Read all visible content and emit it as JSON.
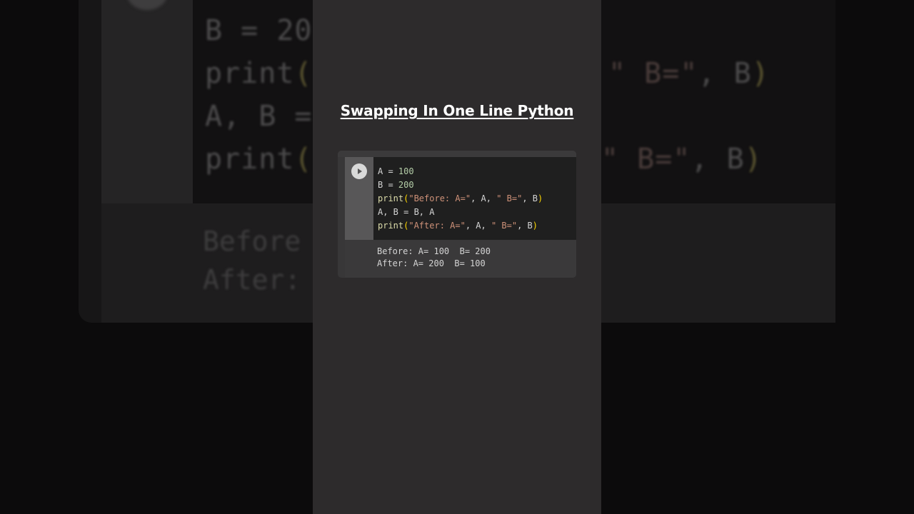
{
  "title": "Swapping In One Line Python",
  "cell": {
    "run_button": "run",
    "code": {
      "line1": {
        "a": "A = ",
        "b": "100"
      },
      "line2": {
        "a": "B = ",
        "b": "200"
      },
      "line3": {
        "fn": "print",
        "p1": "(",
        "s1": "\"Before: A=\"",
        "m1": ", A, ",
        "s2": "\" B=\"",
        "m2": ", B",
        "p2": ")"
      },
      "line4": {
        "a": "A, B = B, A"
      },
      "line5": {
        "fn": "print",
        "p1": "(",
        "s1": "\"After: A=\"",
        "m1": ", A, ",
        "s2": "\" B=\"",
        "m2": ", B",
        "p2": ")"
      }
    },
    "output": {
      "line1": "Before: A= 100  B= 200",
      "line2": "After: A= 200  B= 100"
    }
  },
  "backdrop": {
    "line_b": "B = 20",
    "line_print1_fn": "print",
    "line_print1_paren": "(",
    "line_print1_tail_s": "\" B=\"",
    "line_print1_tail_m": ", B",
    "line_print1_tail_p": ")",
    "line_swap": "A, B =",
    "line_print2_fn": "print",
    "line_print2_paren": "(",
    "line_print2_tail_s": "\" B=\"",
    "line_print2_tail_m": ", B",
    "line_print2_tail_p": ")",
    "out1": "Before",
    "out2": "After:"
  },
  "colors": {
    "frame": "#2d2b2c",
    "code_bg": "#1f1f1f",
    "output_bg": "#3a393a",
    "number": "#b5cea8",
    "function": "#dcdcaa",
    "string": "#ce9178",
    "paren": "#ffd700"
  },
  "icons": {
    "run": "play-icon"
  }
}
